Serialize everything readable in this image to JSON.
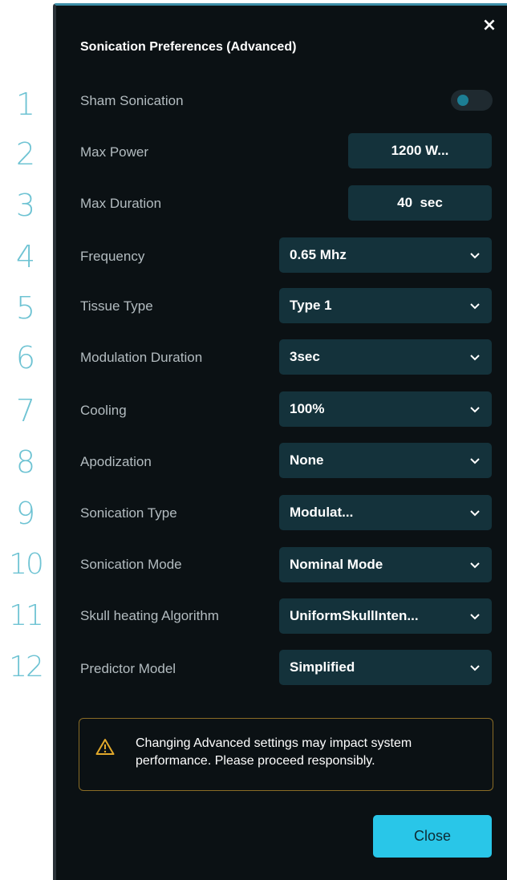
{
  "dialog": {
    "title": "Sonication Preferences (Advanced)",
    "close_glyph": "×"
  },
  "row_numbers": [
    "1",
    "2",
    "3",
    "4",
    "5",
    "6",
    "7",
    "8",
    "9",
    "10",
    "11",
    "12"
  ],
  "settings": [
    {
      "label": "Sham Sonication",
      "type": "toggle",
      "on": false
    },
    {
      "label": "Max Power",
      "type": "field",
      "value": "1200 W..."
    },
    {
      "label": "Max Duration",
      "type": "field",
      "value": "40  sec"
    },
    {
      "label": "Frequency",
      "type": "dropdown",
      "value": "0.65 Mhz"
    },
    {
      "label": "Tissue Type",
      "type": "dropdown",
      "value": "Type 1"
    },
    {
      "label": "Modulation Duration",
      "type": "dropdown",
      "value": "3sec"
    },
    {
      "label": "Cooling",
      "type": "dropdown",
      "value": "100%"
    },
    {
      "label": "Apodization",
      "type": "dropdown",
      "value": "None"
    },
    {
      "label": "Sonication Type",
      "type": "dropdown",
      "value": "Modulat..."
    },
    {
      "label": "Sonication Mode",
      "type": "dropdown",
      "value": "Nominal Mode"
    },
    {
      "label": "Skull heating Algorithm",
      "type": "dropdown",
      "value": "UniformSkullInten..."
    },
    {
      "label": "Predictor Model",
      "type": "dropdown",
      "value": "Simplified"
    }
  ],
  "warning": {
    "icon": "warning-triangle-icon",
    "text": "Changing Advanced settings may impact system performance. Please proceed responsibly."
  },
  "footer": {
    "close_label": "Close"
  },
  "colors": {
    "panel_bg": "#0b1114",
    "control_bg": "#14323b",
    "accent": "#29c6e8",
    "number_color": "#6ec3d3",
    "warning_border": "#8a6c26",
    "warning_icon": "#e2a92b"
  }
}
